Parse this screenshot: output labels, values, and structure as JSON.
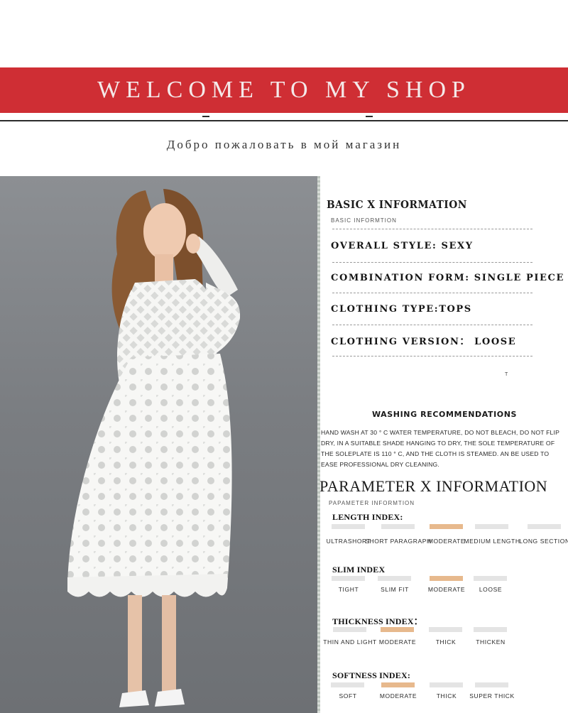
{
  "banner": {
    "title": "WELCOME TO MY SHOP"
  },
  "subtitle": "Добро пожаловать в мой магазин",
  "photo": {
    "description_icon": "model-white-lace-dress-photo"
  },
  "basic_info": {
    "heading": "BASIC X INFORMATION",
    "subheading": "BASIC INFORMTION",
    "specs": [
      {
        "label": "OVERALL STYLE: SEXY"
      },
      {
        "label": "COMBINATION FORM: SINGLE PIECE"
      },
      {
        "label": "CLOTHING TYPE:TOPS"
      },
      {
        "label": "CLOTHING VERSION： LOOSE"
      }
    ],
    "mark": "T"
  },
  "washing": {
    "title": "WASHING RECOMMENDATIONS",
    "text": "Hand wash at 30 ° C water temperature, do not bleach,  do not flip dry, in a suitable shade hanging to dry, the sole temperature of the soleplate is 110 ° C, and the cloth is steamed. An be used to ease professional dry cleaning."
  },
  "parameters": {
    "heading": "PARAMETER X INFORMATION",
    "subheading": "PAPAMETER INFORMTION",
    "accent_color": "#e7b98d",
    "inactive_color": "#e4e4e4",
    "groups": [
      {
        "title": "LENGTH INDEX:",
        "selected": 2,
        "options": [
          "ULTRASHORT",
          "SHORT PARAGRAPH",
          "MODERATE",
          "MEDIUM LENGTH",
          "LONG SECTION"
        ]
      },
      {
        "title": "SLIM INDEX",
        "selected": 2,
        "options": [
          "TIGHT",
          "SLIM FIT",
          "MODERATE",
          "LOOSE"
        ]
      },
      {
        "title": "THICKNESS INDEX：",
        "selected": 1,
        "options": [
          "THIN AND LIGHT",
          "MODERATE",
          "THICK",
          "THICKEN"
        ]
      },
      {
        "title": "SOFTNESS INDEX:",
        "selected": 1,
        "options": [
          "SOFT",
          "MODERATE",
          "THICK",
          "SUPER THICK"
        ]
      }
    ]
  }
}
